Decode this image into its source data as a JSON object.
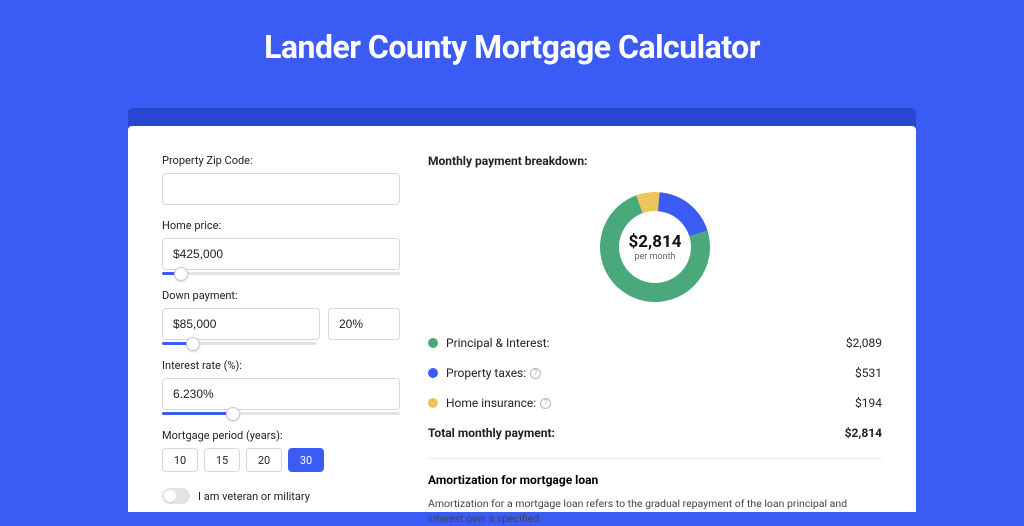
{
  "title": "Lander County Mortgage Calculator",
  "form": {
    "zip_label": "Property Zip Code:",
    "zip_value": "",
    "home_price_label": "Home price:",
    "home_price_value": "$425,000",
    "home_price_slider_pct": 8,
    "down_payment_label": "Down payment:",
    "down_payment_value": "$85,000",
    "down_payment_pct_value": "20%",
    "down_payment_slider_pct": 20,
    "interest_label": "Interest rate (%):",
    "interest_value": "6.230%",
    "interest_slider_pct": 30,
    "period_label": "Mortgage period (years):",
    "period_options": [
      "10",
      "15",
      "20",
      "30"
    ],
    "period_active_index": 3,
    "veteran_label": "I am veteran or military"
  },
  "breakdown": {
    "title": "Monthly payment breakdown:",
    "center_value": "$2,814",
    "center_sub": "per month",
    "rows": [
      {
        "label": "Principal & Interest:",
        "value": "$2,089",
        "color": "#49a97b",
        "info": false
      },
      {
        "label": "Property taxes:",
        "value": "$531",
        "color": "#3b5bf5",
        "info": true
      },
      {
        "label": "Home insurance:",
        "value": "$194",
        "color": "#ecc55b",
        "info": true
      }
    ],
    "total_label": "Total monthly payment:",
    "total_value": "$2,814"
  },
  "chart_data": {
    "type": "pie",
    "title": "Monthly payment breakdown",
    "series": [
      {
        "name": "Principal & Interest",
        "value": 2089,
        "color": "#49a97b"
      },
      {
        "name": "Property taxes",
        "value": 531,
        "color": "#3b5bf5"
      },
      {
        "name": "Home insurance",
        "value": 194,
        "color": "#ecc55b"
      }
    ],
    "total": 2814,
    "center_label": "$2,814",
    "center_sub": "per month"
  },
  "amortization": {
    "title": "Amortization for mortgage loan",
    "body": "Amortization for a mortgage loan refers to the gradual repayment of the loan principal and interest over a specified"
  }
}
